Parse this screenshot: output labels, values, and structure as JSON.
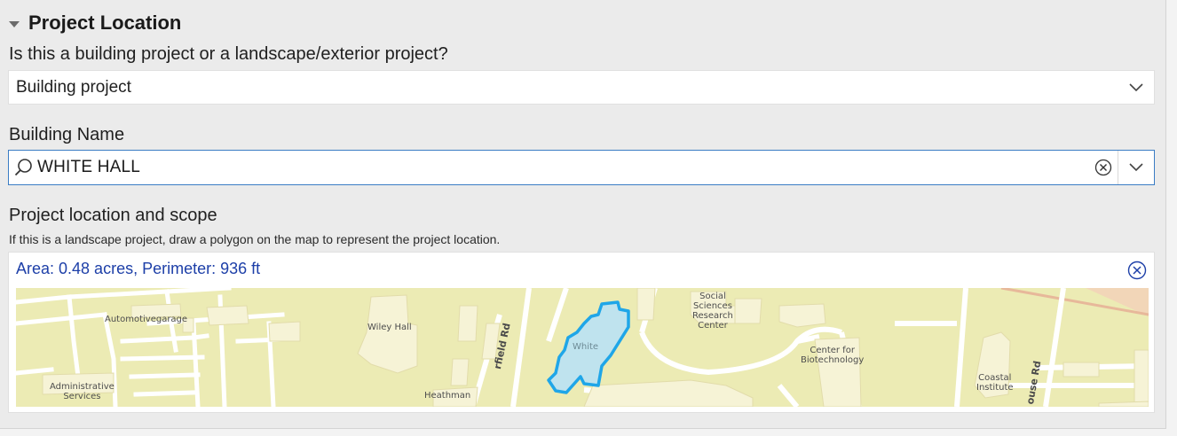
{
  "section": {
    "title": "Project Location"
  },
  "project_type": {
    "question": "Is this a building project or a landscape/exterior project?",
    "selected": "Building project"
  },
  "building": {
    "label": "Building Name",
    "value": "WHITE HALL"
  },
  "location": {
    "label": "Project location and scope",
    "help": "If this is a landscape project, draw a polygon on the map to represent the project location.",
    "measurement": "Area: 0.48 acres, Perimeter: 936 ft"
  },
  "map": {
    "labels": {
      "automotive": "Automotivegarage",
      "administrative_1": "Administrative",
      "administrative_2": "Services",
      "wiley": "Wiley Hall",
      "heathman": "Heathman",
      "white": "White",
      "social_1": "Social",
      "social_2": "Sciences",
      "social_3": "Research",
      "social_4": "Center",
      "biotech_1": "Center for",
      "biotech_2": "Biotechnology",
      "coastal_1": "Coastal",
      "coastal_2": "Institute",
      "road_left": "rfield Rd",
      "road_right": "ouse Rd"
    },
    "colors": {
      "land": "#ecebb4",
      "building": "#f6f3d6",
      "road": "#ffffff",
      "selection_stroke": "#1fa6e8",
      "selection_fill": "#bfe3ee"
    }
  }
}
